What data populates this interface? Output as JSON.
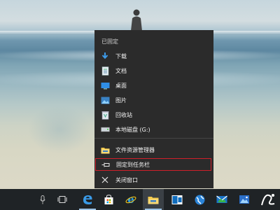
{
  "jumplist": {
    "header": "已固定",
    "pinned": [
      {
        "label": "下载",
        "icon": "download-arrow-icon"
      },
      {
        "label": "文档",
        "icon": "document-icon"
      },
      {
        "label": "桌面",
        "icon": "desktop-icon"
      },
      {
        "label": "图片",
        "icon": "pictures-icon"
      },
      {
        "label": "回收站",
        "icon": "recycle-bin-icon"
      },
      {
        "label": "本地磁盘 (G:)",
        "icon": "drive-icon"
      }
    ],
    "actions": [
      {
        "label": "文件资源管理器",
        "icon": "file-explorer-icon"
      },
      {
        "label": "固定到任务栏",
        "icon": "pin-icon",
        "highlighted": true
      },
      {
        "label": "关闭窗口",
        "icon": "close-icon"
      }
    ],
    "highlight_color": "#d0202a"
  },
  "taskbar": {
    "items": [
      "microphone-icon",
      "task-view-icon",
      "edge-icon",
      "store-icon",
      "ie-icon",
      "file-explorer-icon",
      "outlook-icon",
      "globe-icon",
      "mail-icon",
      "watermark-logo-icon"
    ],
    "active": "file-explorer-icon"
  },
  "colors": {
    "menu_bg": "#2b2b2b",
    "taskbar_bg": "#1f2326",
    "accent": "#2f8ee6"
  }
}
